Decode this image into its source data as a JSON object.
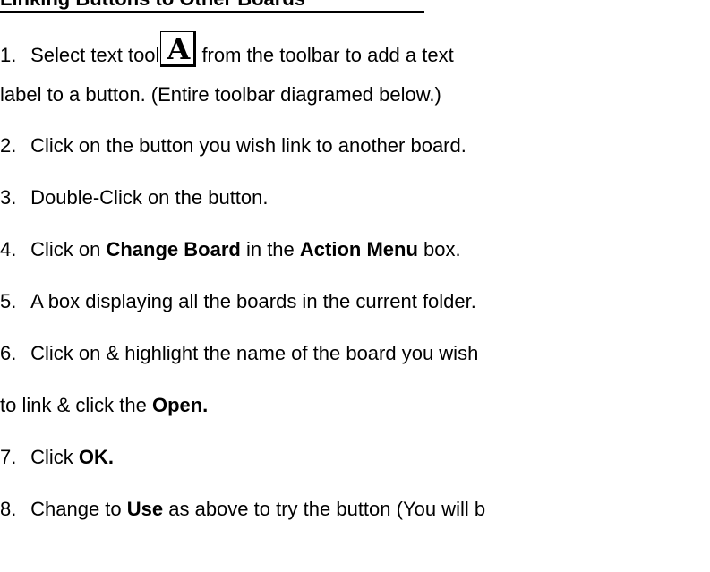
{
  "document": {
    "heading": "Linking Buttons to Other Boards",
    "steps": [
      {
        "number": "1.",
        "before_icon": "Select text tool",
        "icon": "text-tool-icon",
        "icon_glyph": "A",
        "after_icon": "from the toolbar to add a text",
        "continuation": "label to a button. (Entire toolbar diagramed below.)"
      },
      {
        "number": "2.",
        "text": "Click on the button you wish link to another board."
      },
      {
        "number": "3.",
        "text": "Double-Click on the button."
      },
      {
        "number": "4.",
        "pre": "Click on ",
        "bold1": "Change Board",
        "mid": " in the ",
        "bold2": "Action Menu",
        "post": " box."
      },
      {
        "number": "5.",
        "text": "A box displaying all the boards in the current folder."
      },
      {
        "number": "6.",
        "text": "Click on & highlight the name of the board you wish",
        "continuation_pre": "to link & click the ",
        "continuation_bold": "Open."
      },
      {
        "number": "7.",
        "pre": "Click ",
        "bold": "OK."
      },
      {
        "number": "8.",
        "pre": "Change to ",
        "bold": "Use",
        "post": " as above to try the button (You will b"
      }
    ]
  }
}
